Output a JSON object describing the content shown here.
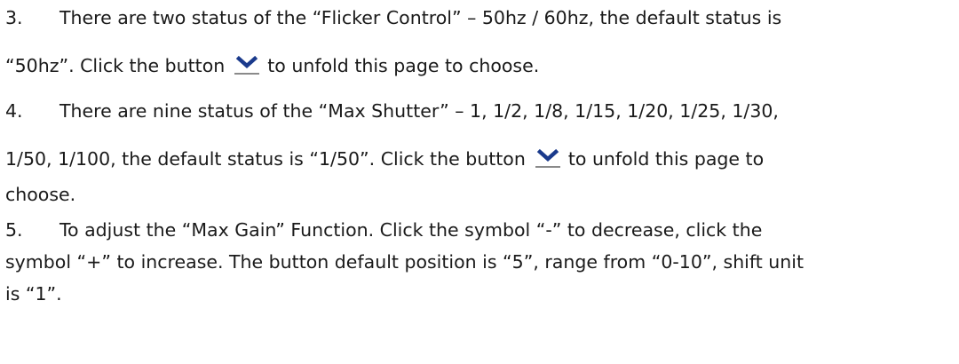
{
  "items": [
    {
      "number": "3.",
      "line1": "There are two status of the “Flicker Control” – 50hz / 60hz, the default status is",
      "line2_before": "“50hz”. Click the button",
      "line2_after": "to unfold this page to choose."
    },
    {
      "number": "4.",
      "line1": "There are nine status of the “Max Shutter” – 1, 1/2, 1/8, 1/15, 1/20, 1/25, 1/30,",
      "line2_before": "1/50, 1/100, the default status is “1/50”. Click the button",
      "line2_after": "to unfold this page to",
      "line3": "choose."
    },
    {
      "number": "5.",
      "line1": "To adjust the “Max Gain” Function. Click the symbol “-” to decrease, click the",
      "line2": "symbol “+” to increase. The button default position is “5”, range from “0-10”, shift unit",
      "line3": "is “1”."
    }
  ],
  "icons": {
    "dropdown": "chevron-down-icon",
    "dropdown_color": "#1a3a8c"
  }
}
